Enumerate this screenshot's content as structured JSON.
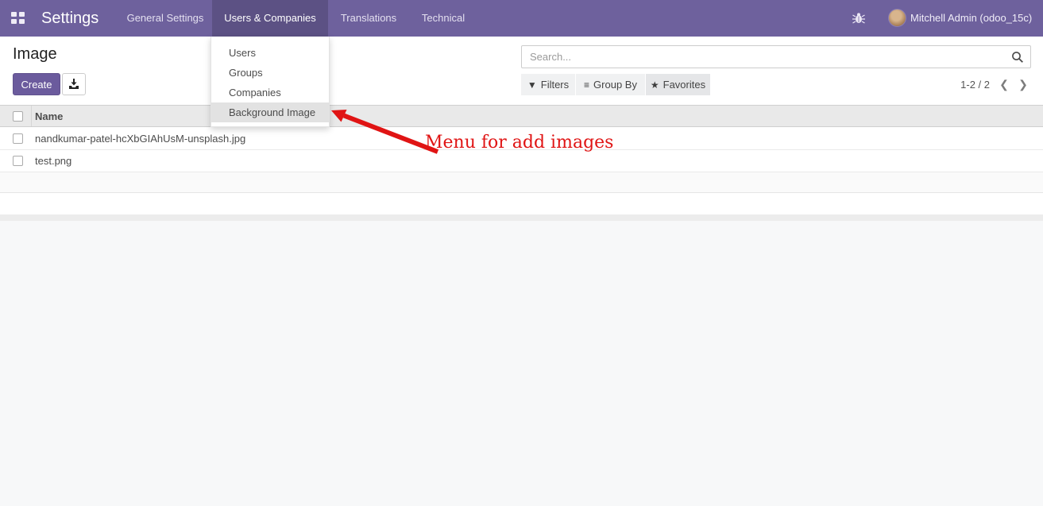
{
  "topbar": {
    "app_title": "Settings",
    "menus": [
      {
        "label": "General Settings"
      },
      {
        "label": "Users & Companies"
      },
      {
        "label": "Translations"
      },
      {
        "label": "Technical"
      }
    ],
    "user_name": "Mitchell Admin (odoo_15c)"
  },
  "dropdown": {
    "items": [
      {
        "label": "Users"
      },
      {
        "label": "Groups"
      },
      {
        "label": "Companies"
      },
      {
        "label": "Background Image"
      }
    ]
  },
  "page": {
    "title": "Image",
    "create_label": "Create"
  },
  "search": {
    "placeholder": "Search..."
  },
  "filters_bar": {
    "filters_label": "Filters",
    "group_by_label": "Group By",
    "favorites_label": "Favorites"
  },
  "pager": {
    "range": "1-2 / 2",
    "prev": "❮",
    "next": "❯"
  },
  "table": {
    "name_header": "Name",
    "rows": [
      {
        "name": "nandkumar-patel-hcXbGIAhUsM-unsplash.jpg"
      },
      {
        "name": "test.png"
      }
    ]
  },
  "annotation": {
    "text": "Menu for add images"
  },
  "icons": {
    "apps": "apps-grid-icon",
    "bug": "debug-bug-icon",
    "import": "import-download-icon",
    "search": "search-icon",
    "filter": "▼",
    "group_by": "≡",
    "favorites": "★"
  },
  "colors": {
    "topbar_bg": "#6e619d",
    "topbar_active_bg": "#5c5184",
    "primary_button_bg": "#6b5b9d",
    "dropdown_highlight": "#e2e2e2",
    "annotation_red": "#e01414"
  }
}
